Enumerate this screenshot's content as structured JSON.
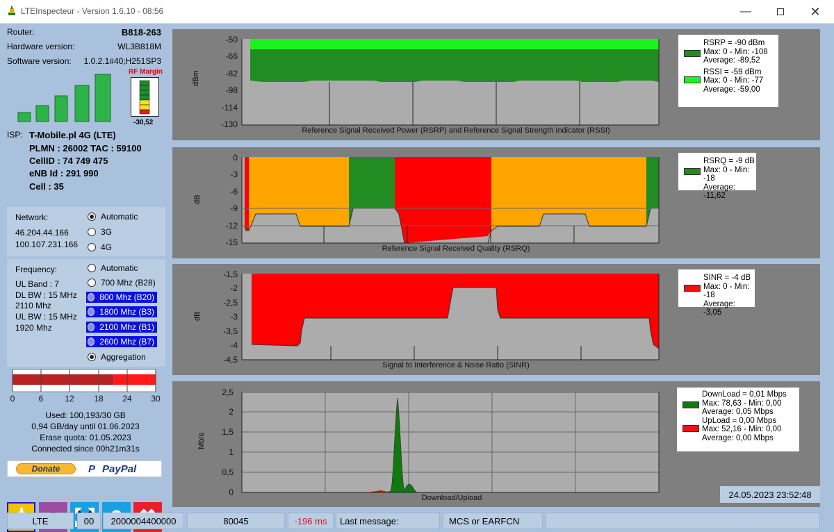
{
  "window": {
    "title": "LTEInspecteur - Version 1.6.10 - 08:56",
    "icon": "app-icon"
  },
  "device": {
    "router_label": "Router:",
    "router_value": "B818-263",
    "hw_label": "Hardware version:",
    "hw_value": "WL3B818M",
    "sw_label": "Software version:",
    "sw_value": "1.0.2.1#40;H251SP3",
    "rf_margin_label": "RF Margin",
    "rf_margin_value": "-30,52",
    "signal_bars_level": 5
  },
  "isp": {
    "label": "ISP:",
    "name": "T-Mobile.pl 4G (LTE)",
    "plmn": "PLMN : 26002 TAC : 59100",
    "cellid": "CellID : 74 749 475",
    "enb": "eNB Id : 291 990",
    "cell": "Cell : 35"
  },
  "network": {
    "label": "Network:",
    "ip1": "46.204.44.166",
    "ip2": "100.107.231.166",
    "options": [
      "Automatic",
      "3G",
      "4G"
    ],
    "selected": "Automatic"
  },
  "frequency": {
    "label": "Frequency:",
    "info": [
      "UL Band : 7",
      "DL BW : 15 MHz",
      "2110 Mhz",
      "UL BW : 15 MHz",
      "1920 Mhz"
    ],
    "options": [
      "Automatic",
      "700 Mhz (B28)",
      "800 Mhz (B20)",
      "1800 Mhz (B3)",
      "2100 Mhz (B1)",
      "2600 Mhz (B7)",
      "Aggregation"
    ],
    "highlighted": [
      "800 Mhz (B20)",
      "1800 Mhz (B3)",
      "2100 Mhz (B1)",
      "2600 Mhz (B7)"
    ],
    "selected": "Aggregation"
  },
  "quota": {
    "scale_labels": [
      "0",
      "6",
      "12",
      "18",
      "24",
      "30"
    ],
    "used_fraction_dark": 0.707,
    "used_fraction_total": 1.0,
    "used": "Used: 100,193/30 GB",
    "per_day": "0,94 GB/day until 01.06.2023",
    "erase": "Erase quota: 01.05.2023",
    "connected": "Connected since 00h21m31s"
  },
  "donate": {
    "donate_label": "Donate",
    "paypal_label": "PayPal"
  },
  "toolbar": [
    "settings-gear-icon",
    "speedometer-icon",
    "fullscreen-arrows-icon",
    "help-icon",
    "close-x-icon"
  ],
  "charts": [
    {
      "id": "rsrp",
      "ylabel": "dBm",
      "ticks": [
        "-50",
        "-66",
        "-82",
        "-98",
        "-114",
        "-130"
      ],
      "caption": "Reference Signal Received Power (RSRP) and Reference Signal Strength Indicator (RSSI)",
      "legend": [
        {
          "color": "#218c21",
          "lines": [
            "RSRP = -90 dBm",
            "Max: 0 - Min: -108",
            "Average: -89,52"
          ]
        },
        {
          "color": "#1cf31c",
          "lines": [
            "RSSI = -59 dBm",
            "Max: 0 - Min: -77",
            "Average: -59,00"
          ]
        }
      ]
    },
    {
      "id": "rsrq",
      "ylabel": "dB",
      "ticks": [
        "0",
        "-3",
        "-6",
        "-9",
        "-12",
        "-15"
      ],
      "caption": "Reference Signal Received Quality (RSRQ)",
      "legend": [
        {
          "color": "#218c21",
          "lines": [
            "RSRQ = -9 dB",
            "Max: 0 - Min: -18",
            "Average: -11,62"
          ]
        }
      ]
    },
    {
      "id": "sinr",
      "ylabel": "dB",
      "ticks": [
        "-1,5",
        "-2",
        "-2,5",
        "-3",
        "-3,5",
        "-4",
        "-4,5"
      ],
      "caption": "Signal to Interference & Noise Ratio (SINR)",
      "legend": [
        {
          "color": "#ee1111",
          "lines": [
            "SINR = -4 dB",
            "Max: 0 - Min: -18",
            "Average: -3,05"
          ]
        }
      ]
    },
    {
      "id": "traffic",
      "ylabel": "Mb/s",
      "ticks": [
        "2,5",
        "2",
        "1,5",
        "1",
        "0,5",
        "0"
      ],
      "caption": "Download/Upload",
      "legend": [
        {
          "color": "#0f7a0f",
          "lines": [
            "DownLoad = 0,01 Mbps",
            "Max: 78,63 - Min: 0,00",
            "Average: 0,05 Mbps"
          ]
        },
        {
          "color": "#ee1111",
          "lines": [
            "UpLoad = 0,00 Mbps",
            "Max: 52,16 - Min: 0,00",
            "Average: 0,00 Mbps"
          ]
        }
      ]
    }
  ],
  "timestamp": "24.05.2023 23:52:48",
  "statusbar": {
    "mode": "LTE",
    "code": "00",
    "cellhex": "2000004400000",
    "value": "80045",
    "latency": "-196 ms",
    "last_message": "Last message:",
    "mcs": "MCS or EARFCN",
    "extra": ""
  },
  "colors": {
    "background": "#a9c1dc",
    "panel": "#b9cde3",
    "chart_bg": "#7f7f7f",
    "plot_bg": "#acacac",
    "good": "#218c21",
    "warn": "#ffa500",
    "bad": "#ff0000",
    "selected_band": "#0c12e0"
  }
}
